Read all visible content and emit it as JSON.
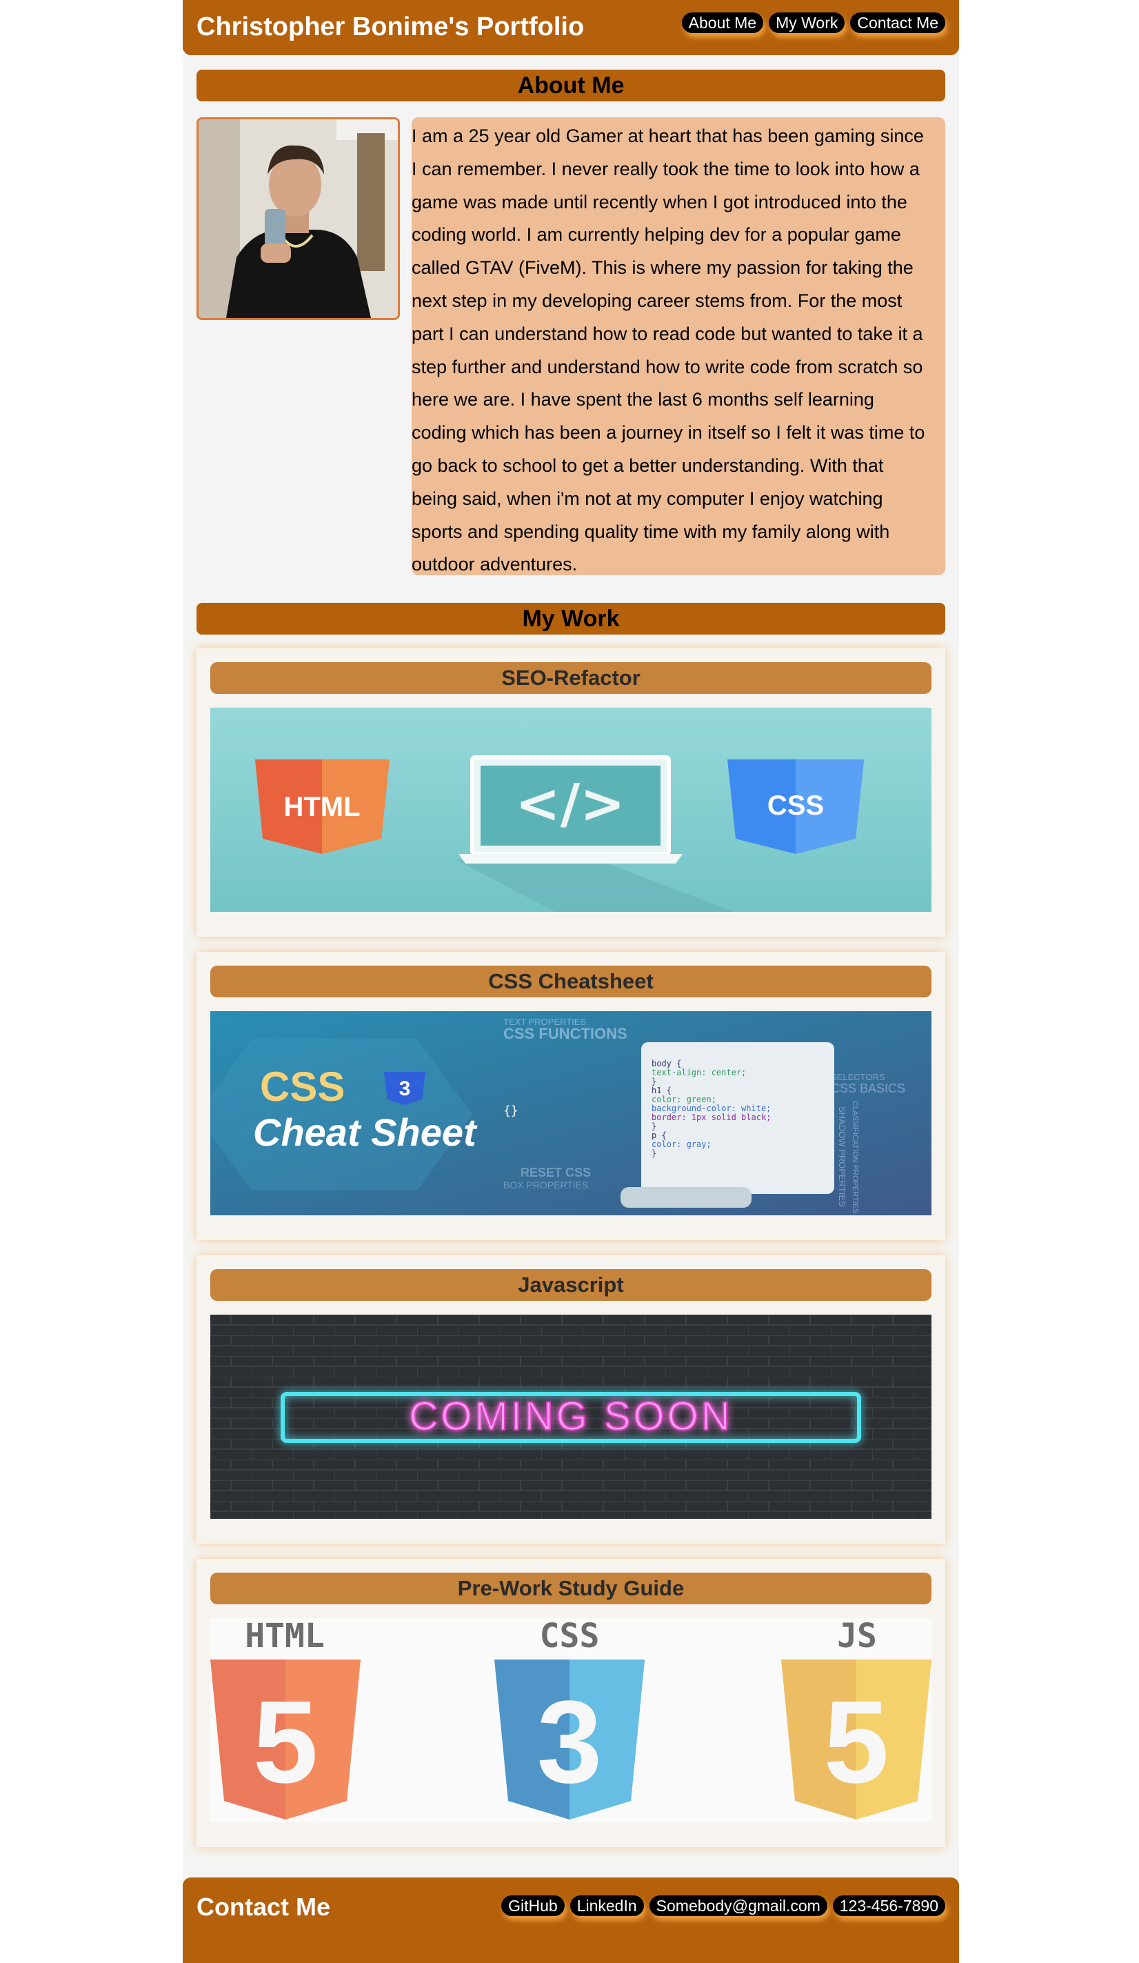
{
  "header": {
    "title": "Christopher Bonime's Portfolio",
    "nav": [
      "About Me",
      "My Work",
      "Contact Me"
    ]
  },
  "about": {
    "heading": "About Me",
    "lines": [
      "I am a 25 year old Gamer at heart that has been gaming since",
      "I can remember. I never really took the time to look into how a",
      "game was made until recently when I got introduced into the",
      "coding world. I am currently helping dev for a popular game",
      "called GTAV (FiveM). This is where my passion for taking the",
      "next step in my developing career stems from. For the most",
      "part I can understand how to read code but wanted to take it a",
      "step further and understand how to write code from scratch so",
      "here we are. I have spent the last 6 months self learning",
      "coding which has been a journey in itself so I felt it was time to",
      "go back to school to get a better understanding. With that",
      "being said, when i'm not at my computer I enjoy watching",
      "sports and spending quality time with my family along with",
      "outdoor adventures."
    ]
  },
  "work": {
    "heading": "My Work",
    "projects": [
      {
        "title": "SEO-Refactor",
        "image": {
          "left_badge": "HTML",
          "center": "</>",
          "right_badge": "CSS"
        }
      },
      {
        "title": "CSS Cheatsheet",
        "image": {
          "brand": "CSS",
          "subtitle": "Cheat Sheet",
          "braces": "{}",
          "tags": [
            "TEXT PROPERTIES",
            "CSS FUNCTIONS",
            "SELECTORS",
            "CSS BASICS",
            "RESET CSS",
            "BOX PROPERTIES",
            "SHADOW PROPERTIES",
            "CLASSIFICATION PROPERTIES"
          ],
          "code": [
            "body {",
            "  text-align: center;",
            "}",
            "h1 {",
            "  color: green;",
            "  background-color: white;",
            "  border: 1px solid black;",
            "}",
            "p {",
            "  color: gray;",
            "}"
          ]
        }
      },
      {
        "title": "Javascript",
        "image": {
          "sign": "COMING SOON"
        }
      },
      {
        "title": "Pre-Work Study Guide",
        "image": {
          "logos": [
            {
              "label": "HTML",
              "digit": "5"
            },
            {
              "label": "CSS",
              "digit": "3"
            },
            {
              "label": "JS",
              "digit": "5"
            }
          ]
        }
      }
    ]
  },
  "footer": {
    "title": "Contact Me",
    "links": [
      "GitHub",
      "LinkedIn",
      "Somebody@gmail.com",
      "123-456-7890"
    ]
  },
  "colors": {
    "brand": "#b5600b",
    "card_header": "#c5833b",
    "about_bg": "#eebd96",
    "page_bg": "#f4f4f4"
  }
}
